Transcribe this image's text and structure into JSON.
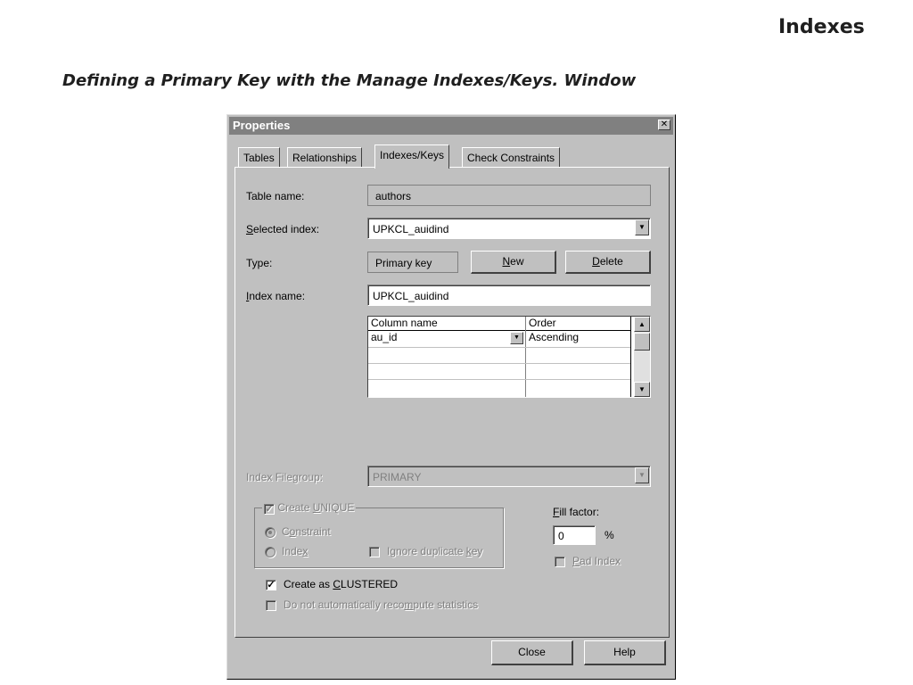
{
  "slide": {
    "title": "Indexes",
    "subtitle": "Defining a Primary Key with the Manage Indexes/Keys. Window"
  },
  "dialog": {
    "title": "Properties",
    "close_glyph": "✕",
    "tabs": [
      {
        "label": "Tables",
        "active": false
      },
      {
        "label": "Relationships",
        "active": false
      },
      {
        "label": "Indexes/Keys",
        "active": true
      },
      {
        "label": "Check Constraints",
        "active": false
      }
    ],
    "table_name": {
      "label": "Table name:",
      "value": "authors"
    },
    "selected_index": {
      "label_pre": "",
      "label_mn": "S",
      "label_post": "elected index:",
      "value": "UPKCL_auidind"
    },
    "type": {
      "label": "Type:",
      "value": "Primary key"
    },
    "new_button": {
      "mn": "N",
      "rest": "ew"
    },
    "delete_button": {
      "mn": "D",
      "rest": "elete"
    },
    "index_name": {
      "label_mn": "I",
      "label_post": "ndex name:",
      "value": "UPKCL_auidind"
    },
    "columns_grid": {
      "headers": [
        "Column name",
        "Order"
      ],
      "rows": [
        {
          "column": "au_id",
          "order": "Ascending"
        }
      ]
    },
    "filegroup": {
      "label_pre": "Index File",
      "label_mn": "g",
      "label_post": "roup:",
      "value": "PRIMARY"
    },
    "create_unique": {
      "label_pre": "Create ",
      "label_mn": "U",
      "label_post": "NIQUE",
      "checked": true,
      "enabled": false
    },
    "constraint_radio": {
      "label_pre": "C",
      "label_mn": "o",
      "label_post": "nstraint",
      "selected": true
    },
    "index_radio": {
      "label_pre": "Inde",
      "label_mn": "x",
      "label_post": "",
      "selected": false
    },
    "ignore_duplicate": {
      "label_pre": "Ignore duplicate ",
      "label_mn": "k",
      "label_post": "ey",
      "checked": false
    },
    "fill_factor": {
      "label_mn": "F",
      "label_post": "ill factor:",
      "value": "0",
      "unit": "%"
    },
    "pad_index": {
      "label_mn": "P",
      "label_post": "ad Index",
      "checked": false
    },
    "create_clustered": {
      "label_pre": "Create as ",
      "label_mn": "C",
      "label_post": "LUSTERED",
      "checked": true
    },
    "no_recompute": {
      "label_pre": "Do not automatically reco",
      "label_mn": "m",
      "label_post": "pute statistics",
      "checked": false
    },
    "close_button": "Close",
    "help_button": "Help"
  },
  "icons": {
    "dropdown": "down-arrow",
    "scroll_up": "up-arrow",
    "scroll_down": "down-arrow",
    "check": "checkmark"
  }
}
